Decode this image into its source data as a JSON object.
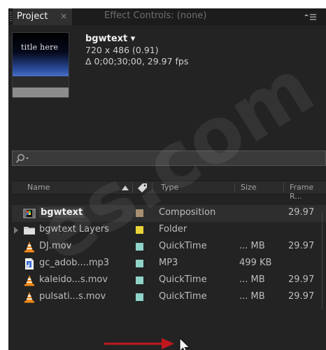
{
  "tabs": {
    "project": "Project",
    "project_close": "×",
    "effect_controls": "Effect Controls: (none)"
  },
  "preview": {
    "thumb_text": "title here",
    "name": "bgwtext ▾",
    "dimensions": "720 x 486 (0.91)",
    "duration": "Δ 0;00;30;00, 29.97 fps"
  },
  "search": {
    "placeholder": ""
  },
  "columns": {
    "name": "Name",
    "type": "Type",
    "size": "Size",
    "frame_rate": "Frame R..."
  },
  "rows": [
    {
      "name": "bgwtext",
      "type": "Composition",
      "size": "",
      "frame_rate": "29.97",
      "label_color": "#a88f72",
      "icon": "composition-icon"
    },
    {
      "name": "bgwtext Layers",
      "type": "Folder",
      "size": "",
      "frame_rate": "",
      "label_color": "#e8d33a",
      "icon": "folder-icon"
    },
    {
      "name": "DJ.mov",
      "type": "QuickTime",
      "size": "... MB",
      "frame_rate": "29.97",
      "label_color": "#8fd3c9",
      "icon": "vlc-cone-icon"
    },
    {
      "name": "gc_adob....mp3",
      "type": "MP3",
      "size": "499 KB",
      "frame_rate": "",
      "label_color": "#8fd3c9",
      "icon": "audio-file-icon"
    },
    {
      "name": "kaleido...s.mov",
      "type": "QuickTime",
      "size": "... MB",
      "frame_rate": "29.97",
      "label_color": "#8fd3c9",
      "icon": "vlc-cone-icon"
    },
    {
      "name": "pulsati...s.mov",
      "type": "QuickTime",
      "size": "... MB",
      "frame_rate": "29.97",
      "label_color": "#8fd3c9",
      "icon": "vlc-cone-icon"
    }
  ],
  "colors": {
    "panel_bg": "#232323",
    "annotation_arrow": "#c0171f"
  }
}
